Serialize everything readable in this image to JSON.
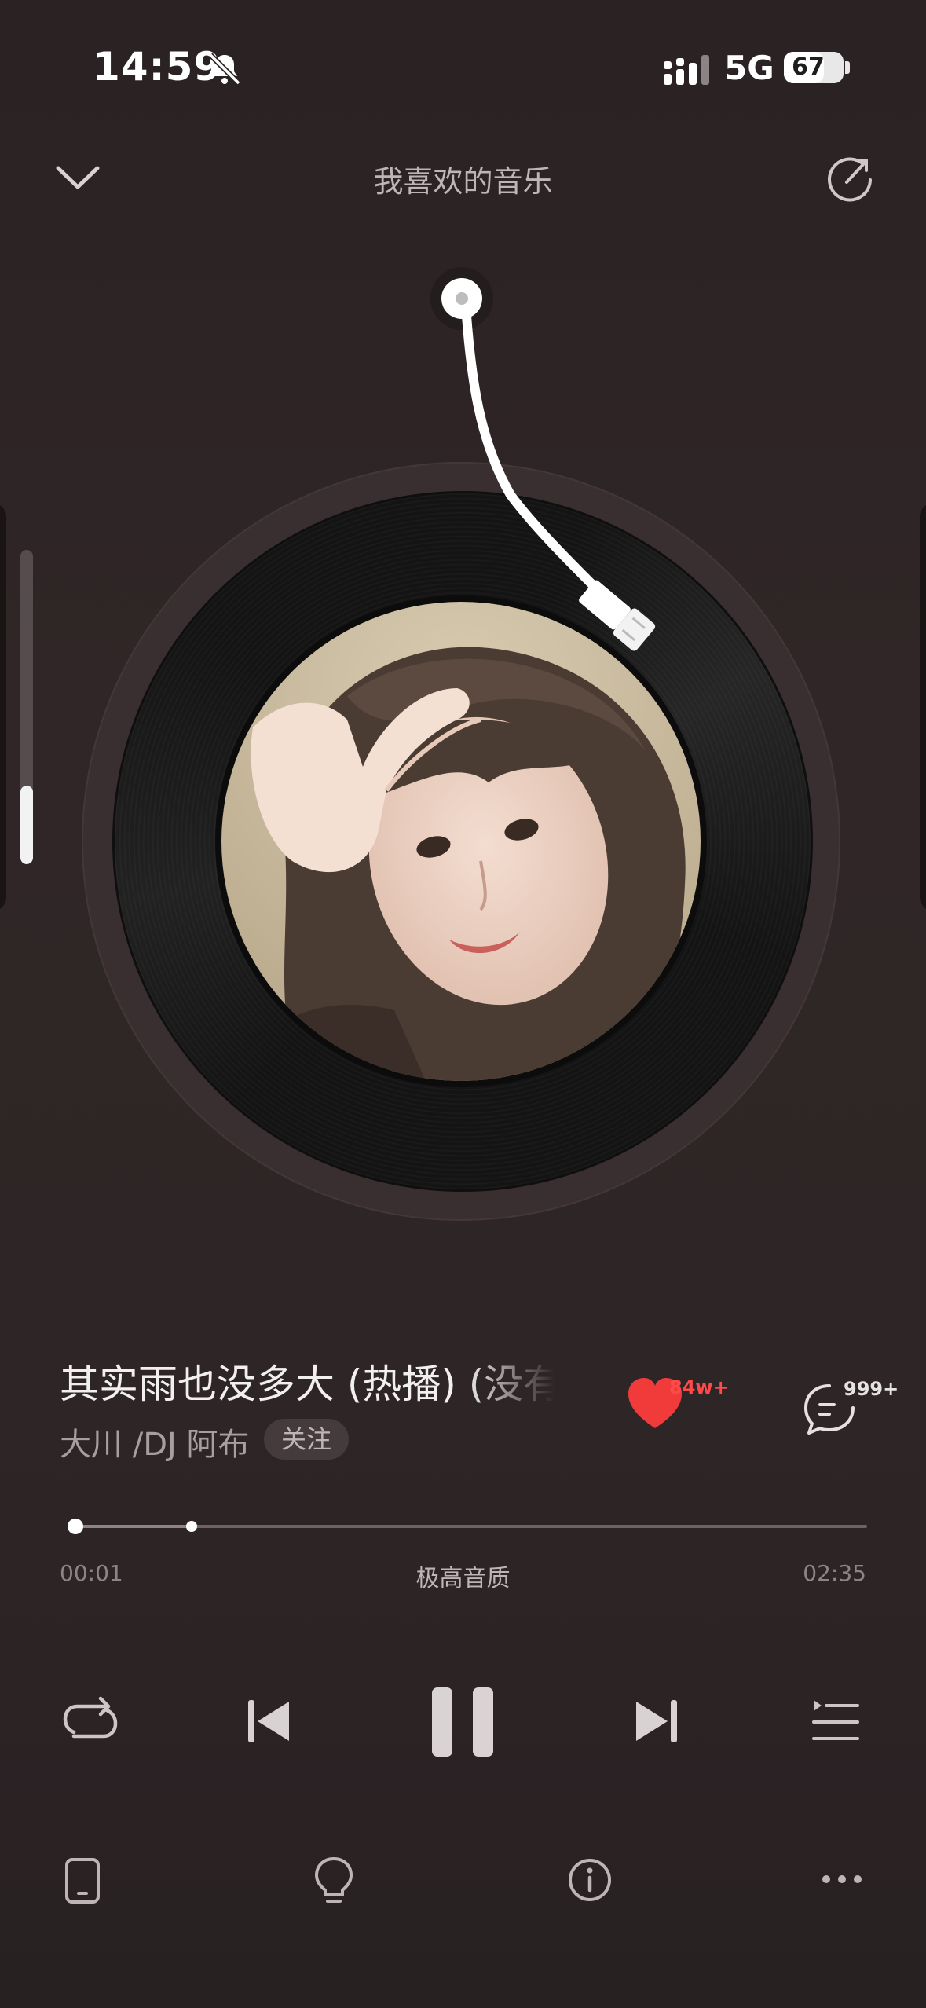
{
  "status_bar": {
    "time": "14:59",
    "network": "5G",
    "battery_level": "67",
    "battery_fraction": 0.67,
    "icons": [
      "bell-muted-icon",
      "signal-icon"
    ]
  },
  "header": {
    "title": "我喜欢的音乐",
    "left_icon": "chevron-down-icon",
    "right_icon": "share-icon"
  },
  "side_slider": {
    "level_fraction": 0.25
  },
  "song": {
    "title": "其实雨也没多大 (热播) (没有",
    "artist": "大川 /DJ 阿布",
    "follow_label": "关注",
    "like_count": "84w+",
    "comment_count": "999+"
  },
  "playback": {
    "current_time": "00:01",
    "total_time": "02:35",
    "quality": "极高音质",
    "progress_fraction": 0.01,
    "buffer_fraction": 0.155
  },
  "controls": {
    "icons": [
      "repeat-icon",
      "previous-icon",
      "pause-icon",
      "next-icon",
      "playlist-icon"
    ]
  },
  "bottom_bar": {
    "icons": [
      "device-icon",
      "lightbulb-icon",
      "info-icon",
      "more-icon"
    ]
  },
  "colors": {
    "background": "#2f2627",
    "like_red": "#ff4a4a",
    "text_primary": "#f1efef",
    "text_secondary": "#a79e9f"
  }
}
